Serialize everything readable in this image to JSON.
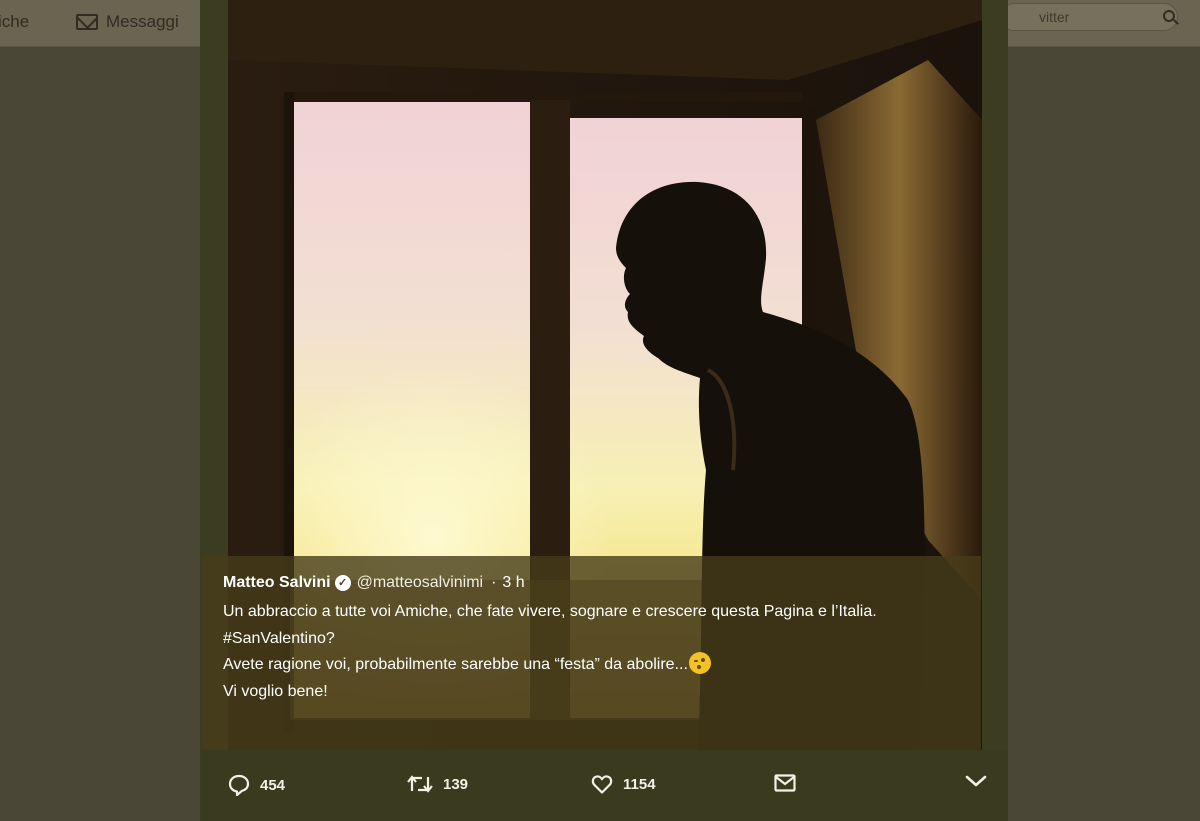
{
  "topbar": {
    "notifications_label": "iche",
    "messages_label": "Messaggi",
    "search_placeholder": "vitter"
  },
  "tweet": {
    "author_name": "Matteo Salvini",
    "verified": true,
    "verified_glyph": "✓",
    "handle": "@matteosalvinimi",
    "separator": "·",
    "time": "3 h",
    "line1": "Un abbraccio a tutte voi Amiche, che fate vivere, sognare e crescere questa Pagina e l’Italia.",
    "hashtag_line": "#SanValentino?",
    "line3": "Avete ragione voi, probabilmente sarebbe una “festa” da abolire...",
    "line3_emoji": "winking-face-emoji",
    "line4": "Vi voglio bene!"
  },
  "actions": {
    "reply_count": "454",
    "retweet_count": "139",
    "like_count": "1154"
  },
  "icons": {
    "reply": "speech-bubble-icon",
    "retweet": "retweet-arrows-icon",
    "like": "heart-icon",
    "direct_message": "envelope-icon",
    "more": "chevron-down-icon",
    "search": "search-icon"
  },
  "colors": {
    "overlay_backdrop": "#4b4737",
    "lightbox_frame": "#3c3c20",
    "text": "#ffffff"
  }
}
